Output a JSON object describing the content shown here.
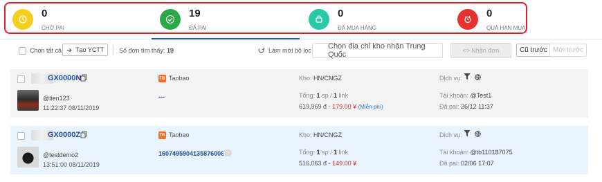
{
  "stats": [
    {
      "count": "0",
      "label": "CHỜ PAI",
      "color": "#f5cf1e",
      "icon": "clock-icon"
    },
    {
      "count": "19",
      "label": "ĐÃ PAI",
      "color": "#2aa845",
      "icon": "check-icon"
    },
    {
      "count": "0",
      "label": "ĐÃ MUA HÀNG",
      "color": "#27c9a6",
      "icon": "bag-icon"
    },
    {
      "count": "0",
      "label": "QUÁ HẠN MUA",
      "color": "#e8312f",
      "icon": "alarm-icon"
    }
  ],
  "toolbar": {
    "select_all": "Chọn tất cả",
    "create_label": "Tạo YCTT",
    "found_label": "Số đơn tìm thấy:",
    "found_count": "19",
    "refresh_label": "Làm mới bộ lọc",
    "warehouse_placeholder": "Chọn địa chỉ kho nhận Trung Quốc",
    "receive_label": "Nhận đơn",
    "prev_label": "Cũ trước",
    "next_label": "Mới trước"
  },
  "orders": [
    {
      "code": "GX0000N",
      "user": "@tien123",
      "time": "11:22:37 08/11/2019",
      "shop": "Taobao",
      "tracking": "---",
      "warehouse_label": "Kho:",
      "warehouse": "HN/CNGZ",
      "total_label": "Tổng:",
      "sp": "1",
      "sp_unit": "sp /",
      "link": "1",
      "link_unit": "link",
      "price_vnd": "619,969 đ",
      "price_cny": "- 179.00 ¥",
      "free": "(Miễn phí)",
      "service_label": "Dịch vụ:",
      "account_label": "Tài khoản:",
      "account": "@Test1",
      "paid_label": "Đã pai:",
      "paid": "26/12 11:37"
    },
    {
      "code": "GX0000Z",
      "user": "@testdemo2",
      "time": "13:51:00 08/11/2019",
      "shop": "Taobao",
      "tracking": "1607495904135876008",
      "tracking_badge": "2+",
      "warehouse_label": "Kho:",
      "warehouse": "HN/CNGZ",
      "total_label": "Tổng:",
      "sp": "1",
      "sp_unit": "sp /",
      "link": "1",
      "link_unit": "link",
      "price_vnd": "516,063 đ",
      "price_cny": "- 149.00 ¥",
      "service_label": "Dịch vụ:",
      "account_label": "Tài khoản:",
      "account": "@tb110187075",
      "paid_label": "Đã pai:",
      "paid": "02/06 17:07"
    }
  ]
}
